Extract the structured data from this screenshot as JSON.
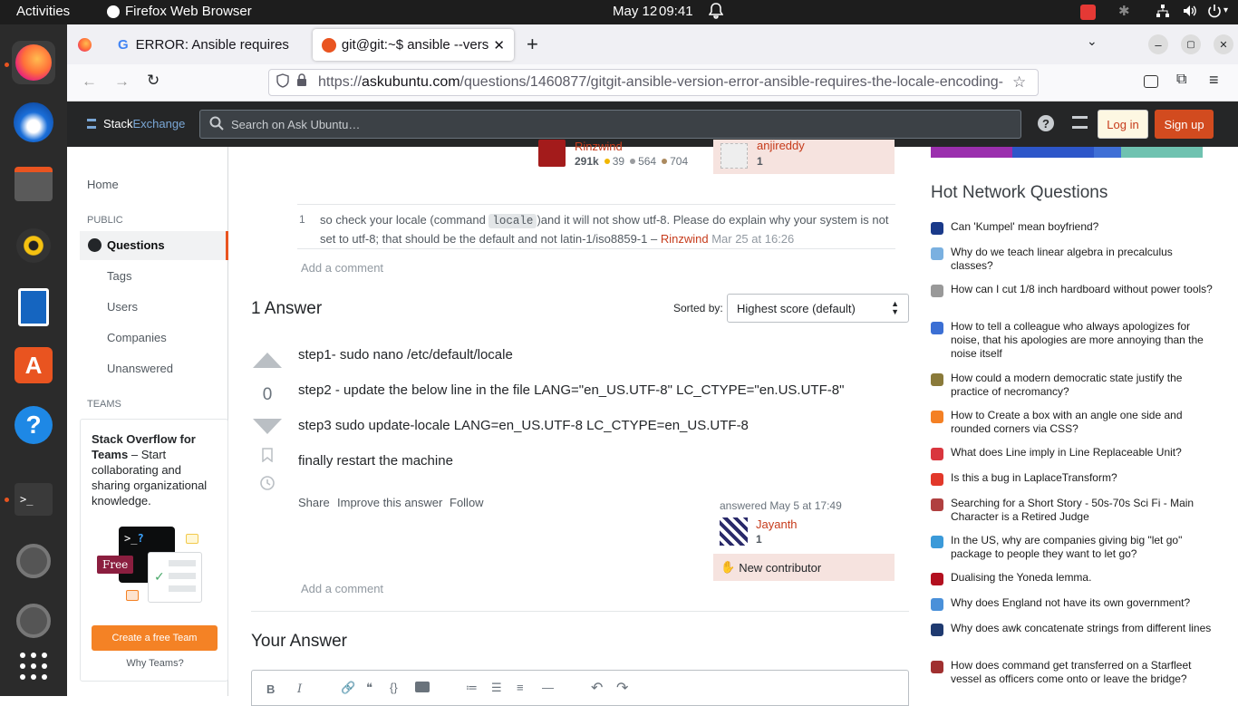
{
  "topbar": {
    "activities": "Activities",
    "app": "Firefox Web Browser",
    "date": "May 12",
    "time": "09:41"
  },
  "browser": {
    "tabs": [
      {
        "title": "ERROR: Ansible requires"
      },
      {
        "title": "git@git:~$ ansible --versi"
      }
    ],
    "url_prefix": "https://",
    "url_domain": "askubuntu.com",
    "url_path": "/questions/1460877/gitgit-ansible-version-error-ansible-requires-the-locale-encoding-"
  },
  "header": {
    "logo_stack": "Stack",
    "logo_exchange": "Exchange",
    "search_placeholder": "Search on Ask Ubuntu…",
    "login": "Log in",
    "signup": "Sign up"
  },
  "leftnav": {
    "home": "Home",
    "public_heading": "PUBLIC",
    "questions": "Questions",
    "tags": "Tags",
    "users": "Users",
    "companies": "Companies",
    "unanswered": "Unanswered",
    "teams_heading": "TEAMS",
    "teams_title": "Stack Overflow for Teams",
    "teams_desc": " – Start collaborating and sharing organizational knowledge.",
    "free_badge": "Free",
    "create_team": "Create a free Team",
    "why_teams": "Why Teams?"
  },
  "question_footer": {
    "user1": {
      "name": "Rinzwind",
      "rep": "291k",
      "gold": "39",
      "silver": "564",
      "bronze": "704"
    },
    "user2": {
      "name": "anjireddy",
      "rep": "1"
    }
  },
  "comment": {
    "score": "1",
    "text_before": "so check your locale (command ",
    "code": "locale",
    "text_after": ")and it will not show utf-8. Please do explain why your system is not set to utf-8; that should be the default and not latin-1/iso8859-1 – ",
    "author": "Rinzwind",
    "date": "Mar 25 at 16:26",
    "add": "Add a comment"
  },
  "answers": {
    "count_label": "1 Answer",
    "sorted_by": "Sorted by:",
    "sort_value": "Highest score (default)"
  },
  "answer": {
    "score": "0",
    "lines": [
      "step1- sudo nano /etc/default/locale",
      "step2 - update the below line in the file LANG=\"en_US.UTF-8\" LC_CTYPE=\"en.US.UTF-8\"",
      "step3 sudo update-locale LANG=en_US.UTF-8 LC_CTYPE=en_US.UTF-8",
      "finally restart the machine"
    ],
    "share": "Share",
    "improve": "Improve this answer",
    "follow": "Follow",
    "answered": "answered May 5 at 17:49",
    "user": "Jayanth",
    "rep": "1",
    "new_contributor": "New contributor",
    "add_comment": "Add a comment"
  },
  "your_answer": "Your Answer",
  "hot": {
    "title": "Hot Network Questions",
    "items": [
      {
        "text": "Can 'Kumpel' mean boyfriend?",
        "color": "#1a3a8a"
      },
      {
        "text": "Why do we teach linear algebra in precalculus classes?",
        "color": "#7ab0e0"
      },
      {
        "text": "How can I cut 1/8 inch hardboard without power tools?",
        "color": "#999999"
      },
      {
        "text": "How to tell a colleague who always apologizes for noise, that his apologies are more annoying than the noise itself",
        "color": "#3b6fd4"
      },
      {
        "text": "How could a modern democratic state justify the practice of necromancy?",
        "color": "#8a7a3a"
      },
      {
        "text": "How to Create a box with an angle one side and rounded corners via CSS?",
        "color": "#f48024"
      },
      {
        "text": "What does Line imply in Line Replaceable Unit?",
        "color": "#d9363e"
      },
      {
        "text": "Is this a bug in LaplaceTransform?",
        "color": "#e2382a"
      },
      {
        "text": "Searching for a Short Story - 50s-70s Sci Fi - Main Character is a Retired Judge",
        "color": "#b04040"
      },
      {
        "text": "In the US, why are companies giving big \"let go\" package to people they want to let go?",
        "color": "#3b9ad9"
      },
      {
        "text": "Dualising the Yoneda lemma.",
        "color": "#b3101f"
      },
      {
        "text": "Why does England not have its own government?",
        "color": "#4a90d9"
      },
      {
        "text": "Why does awk concatenate strings from different lines",
        "color": "#1f3a70"
      },
      {
        "text": "How does command get transferred on a Starfleet vessel as officers come onto or leave the bridge?",
        "color": "#a03030"
      }
    ]
  }
}
